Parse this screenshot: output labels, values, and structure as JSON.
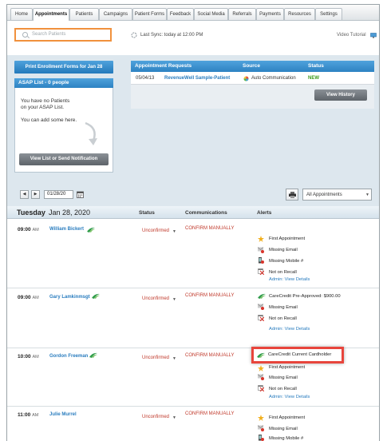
{
  "tabs": [
    "Home",
    "Appointments",
    "Patients",
    "Campaigns",
    "Patient Forms",
    "Feedback",
    "Social Media",
    "Referrals",
    "Payments",
    "Resources",
    "Settings"
  ],
  "search": {
    "placeholder": "Search Patients"
  },
  "sync": {
    "text": "Last Sync: today at 12:00 PM"
  },
  "video_tutorial": "Video Tutorial",
  "print_button": "Print Enrollment Forms for Jan 28",
  "asap": {
    "header": "ASAP List - 0 people",
    "line1": "You have no Patients",
    "line2": "on your ASAP List.",
    "line3": "You can add some here.",
    "button": "View List or Send Notification"
  },
  "requests": {
    "header": "Appointment Requests",
    "col_source": "Source",
    "col_status": "Status",
    "row": {
      "date": "05/04/13",
      "name": "RevenueWell Sample-Patient",
      "source": "Auto Communication",
      "status": "NEW"
    },
    "history_button": "View History"
  },
  "datebar": {
    "date": "01/28/20",
    "filter": "All Appointments"
  },
  "day_header": {
    "day": "Tuesday",
    "date": "Jan 28, 2020",
    "col_status": "Status",
    "col_comm": "Communications",
    "col_alerts": "Alerts"
  },
  "appointments": [
    {
      "time": "09:00",
      "ampm": "AM",
      "name": "William Bickert",
      "status": "Unconfirmed",
      "comm": "CONFIRM MANUALLY",
      "alerts": [
        "First Appointment",
        "Missing Email",
        "Missing Mobile #",
        "Not on Recall"
      ],
      "admin": "Admin: View Details"
    },
    {
      "time": "09:00",
      "ampm": "AM",
      "name": "Gary Lamkinmsgt",
      "status": "Unconfirmed",
      "comm": "CONFIRM MANUALLY",
      "alerts": [
        "CareCredit Pre-Approved: $900.00",
        "Missing Email",
        "Not on Recall"
      ],
      "admin": "Admin: View Details"
    },
    {
      "time": "10:00",
      "ampm": "AM",
      "name": "Gordon Freeman",
      "status": "Unconfirmed",
      "comm": "CONFIRM MANUALLY",
      "alerts": [
        "CareCredit Current Cardholder",
        "First Appointment",
        "Missing Email",
        "Not on Recall"
      ],
      "admin": "Admin: View Details"
    },
    {
      "time": "11:00",
      "ampm": "AM",
      "name": "Julie Murrel",
      "status": "Unconfirmed",
      "comm": "CONFIRM MANUALLY",
      "alerts": [
        "First Appointment",
        "Missing Email",
        "Missing Mobile #"
      ],
      "admin": ""
    }
  ],
  "colors": {
    "accent": "#2a7dbf",
    "highlight": "#e8453c",
    "search_border": "#f1913d",
    "new_status": "#3a9a1a"
  },
  "icons": [
    "search-icon",
    "sync-icon",
    "monitor-icon",
    "prev-arrow-icon",
    "next-arrow-icon",
    "calendar-icon",
    "printer-icon",
    "dropdown-caret-icon",
    "star-icon",
    "missing-email-icon",
    "missing-mobile-icon",
    "not-on-recall-icon",
    "carecredit-icon",
    "auto-communication-icon",
    "curved-arrow-icon"
  ]
}
